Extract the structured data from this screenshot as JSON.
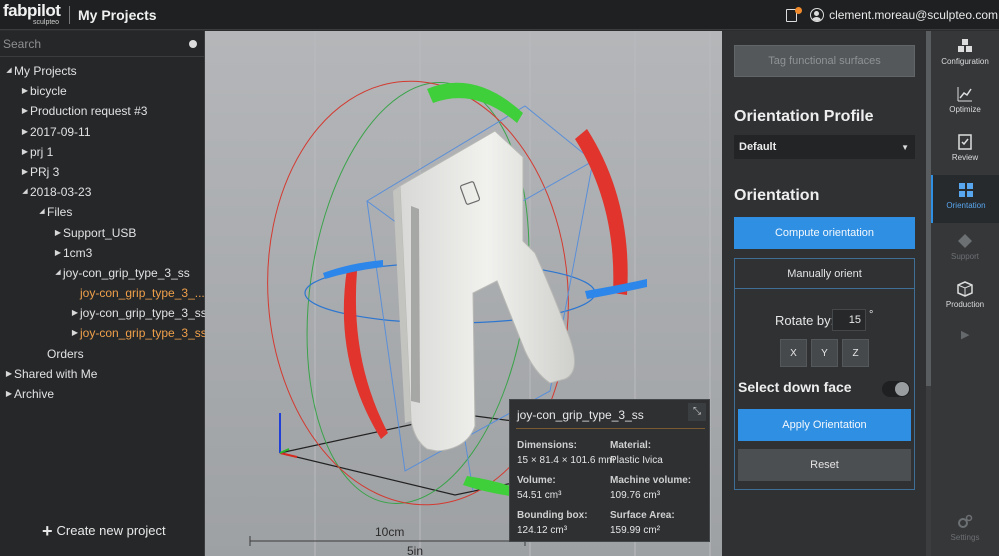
{
  "header": {
    "logo_text": "fabpilot",
    "logo_sub": "sculpteo",
    "title": "My Projects",
    "notification_icon": "clipboard-alert-icon",
    "user_email": "clement.moreau@sculpteo.com"
  },
  "sidebar": {
    "search_placeholder": "Search",
    "tree": [
      {
        "label": "My Projects",
        "level": 0,
        "arrow": "down"
      },
      {
        "label": "bicycle",
        "level": 1,
        "arrow": "right"
      },
      {
        "label": "Production request #3",
        "level": 1,
        "arrow": "right"
      },
      {
        "label": "2017-09-11",
        "level": 1,
        "arrow": "right"
      },
      {
        "label": "prj 1",
        "level": 1,
        "arrow": "right"
      },
      {
        "label": "PRj 3",
        "level": 1,
        "arrow": "right"
      },
      {
        "label": "2018-03-23",
        "level": 1,
        "arrow": "down"
      },
      {
        "label": "Files",
        "level": 2,
        "arrow": "down"
      },
      {
        "label": "Support_USB",
        "level": 3,
        "arrow": "right"
      },
      {
        "label": "1cm3",
        "level": 3,
        "arrow": "right"
      },
      {
        "label": "joy-con_grip_type_3_ss",
        "level": 3,
        "arrow": "down"
      },
      {
        "label": "joy-con_grip_type_3_...",
        "level": 4,
        "arrow": "",
        "orange": true
      },
      {
        "label": "joy-con_grip_type_3_ss",
        "level": 4,
        "arrow": "right"
      },
      {
        "label": "joy-con_grip_type_3_ss",
        "level": 4,
        "arrow": "right",
        "orange": true
      },
      {
        "label": "Orders",
        "level": 2,
        "arrow": ""
      },
      {
        "label": "Shared with Me",
        "level": 0,
        "arrow": "right"
      },
      {
        "label": "Archive",
        "level": 0,
        "arrow": "right"
      }
    ],
    "create_label": "Create new project"
  },
  "viewport": {
    "scale_cm": "10cm",
    "scale_in": "5in"
  },
  "info_card": {
    "name": "joy-con_grip_type_3_ss",
    "dimensions_label": "Dimensions:",
    "dimensions_value": "15 × 81.4 × 101.6 mm",
    "material_label": "Material:",
    "material_value": "Plastic Ivica",
    "volume_label": "Volume:",
    "volume_value": "54.51 cm³",
    "machine_volume_label": "Machine volume:",
    "machine_volume_value": "109.76 cm³",
    "bbox_label": "Bounding box:",
    "bbox_value": "124.12 cm³",
    "surface_label": "Surface Area:",
    "surface_value": "159.99 cm²"
  },
  "panel": {
    "tag_button": "Tag functional surfaces",
    "profile_title": "Orientation Profile",
    "profile_value": "Default",
    "orientation_title": "Orientation",
    "compute_button": "Compute orientation",
    "manual_label": "Manually orient",
    "rotate_label": "Rotate by:",
    "rotate_value": "15",
    "degree": "°",
    "axis_x": "X",
    "axis_y": "Y",
    "axis_z": "Z",
    "select_down_face": "Select down face",
    "apply_button": "Apply Orientation",
    "reset_button": "Reset"
  },
  "nav": [
    {
      "label": "Configuration",
      "icon": "cubes-icon"
    },
    {
      "label": "Optimize",
      "icon": "chart-line-icon"
    },
    {
      "label": "Review",
      "icon": "checklist-icon"
    },
    {
      "label": "Orientation",
      "icon": "orientation-icon",
      "active": true
    },
    {
      "label": "Support",
      "icon": "support-icon",
      "dim": true
    },
    {
      "label": "Production",
      "icon": "box-icon"
    },
    {
      "label": "Settings",
      "icon": "gears-icon",
      "dim": true
    }
  ],
  "colors": {
    "accent": "#2f8fe3",
    "orange": "#f0a04a",
    "ring_green": "#3fcf3a",
    "ring_red": "#e0342c",
    "ring_blue": "#2d86ea"
  }
}
